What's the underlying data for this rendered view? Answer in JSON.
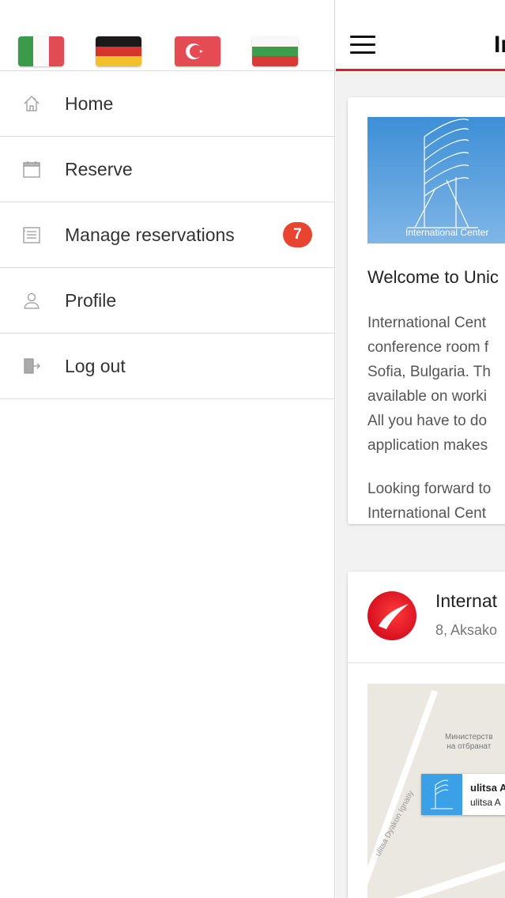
{
  "drawer": {
    "languages": [
      {
        "name": "italian-flag",
        "colors": [
          "#3a9b4a",
          "#ffffff",
          "#e14b54"
        ]
      },
      {
        "name": "german-flag",
        "colors": [
          "#1a1a1a",
          "#d8332c",
          "#f2c028"
        ]
      },
      {
        "name": "turkish-flag",
        "colors": [
          "#e44b52"
        ]
      },
      {
        "name": "bulgarian-flag",
        "colors": [
          "#ffffff",
          "#3c9e4b",
          "#d93a37"
        ]
      }
    ],
    "menu": [
      {
        "label": "Home",
        "icon": "home-icon"
      },
      {
        "label": "Reserve",
        "icon": "calendar-icon"
      },
      {
        "label": "Manage reservations",
        "icon": "list-icon",
        "badge": "7"
      },
      {
        "label": "Profile",
        "icon": "user-icon"
      },
      {
        "label": "Log out",
        "icon": "logout-icon"
      }
    ]
  },
  "header": {
    "title_visible": "In",
    "accent_color": "#d9202b"
  },
  "welcome_card": {
    "image_caption": "International Center",
    "heading": "Welcome to Unic",
    "paragraph1": [
      "International Cent",
      "conference room f",
      "Sofia, Bulgaria. Th",
      "available on worki",
      "All you have to do",
      "application makes"
    ],
    "paragraph2": [
      "Looking forward to",
      "International Cent"
    ]
  },
  "location_card": {
    "name": "Internat",
    "address": "8, Aksako",
    "map": {
      "label_line1": "Министерств",
      "label_line2": "на отбранат",
      "pin_title": "ulitsa A",
      "pin_subtitle": "ulitsa A",
      "street": "ulitsa Dyakon Ignatiy"
    }
  }
}
